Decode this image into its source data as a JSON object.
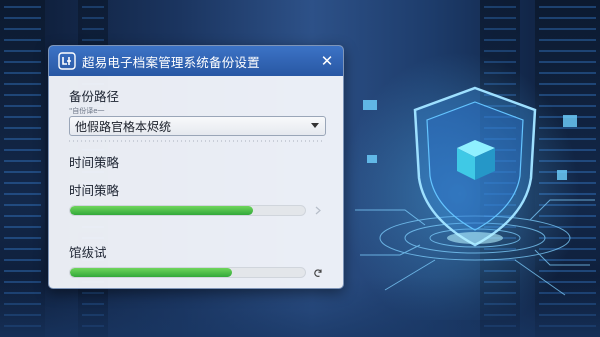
{
  "dialog": {
    "title": "超易电子档案管理系统备份设置",
    "backup_path_label": "备份路径",
    "backup_path_sublabel": "\"自份译e一",
    "backup_path_value": "他假路官格本烬统",
    "time_strategy_header": "时间策略",
    "time_strategy_label": "时间策略",
    "time_strategy_progress": 0.78,
    "test_label": "馆绂试",
    "test_progress": 0.69
  },
  "icons": {
    "app": "app-logo-icon",
    "close": "close-icon",
    "dropdown": "chevron-down-icon",
    "row1": "chevron-right-icon",
    "row2": "refresh-icon"
  },
  "colors": {
    "titlebar": "#2f62b3",
    "progress_fill": "#3fb244",
    "background": "#1b3560"
  }
}
